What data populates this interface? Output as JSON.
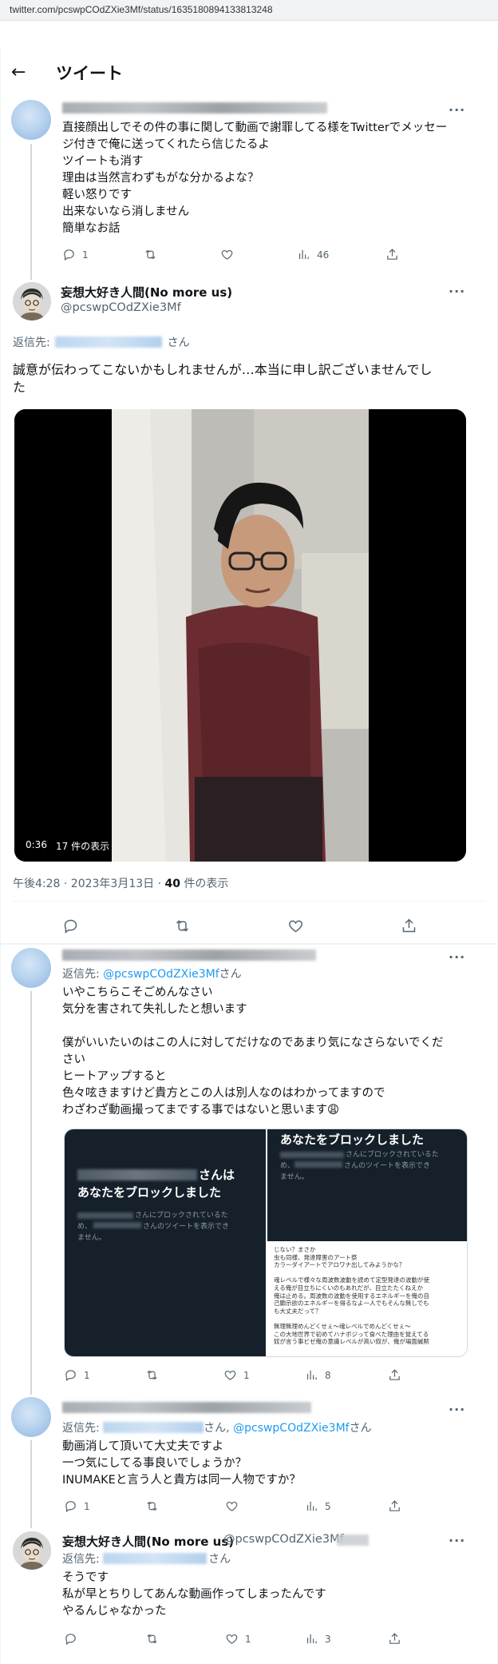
{
  "browser": {
    "url": "twitter.com/pcswpCOdZXie3Mf/status/1635180894133813248"
  },
  "header": {
    "back_icon": "←",
    "title": "ツイート"
  },
  "tweet1": {
    "lines": [
      "直接顔出しでその件の事に関して動画で謝罪してる様をTwitterでメッセー",
      "ジ付きで俺に送ってくれたら信じたるよ",
      "ツイートも消す",
      "理由は当然言わずもがな分かるよな？",
      "軽い怒りです",
      "出来ないなら消しません",
      "簡単なお話"
    ],
    "replies": "1",
    "views": "46"
  },
  "main": {
    "name": "妄想大好き人間(No more us)",
    "handle": "@pcswpCOdZXie3Mf",
    "reply_prefix": "返信先:",
    "reply_suffix": "さん",
    "text_line1": "誠意が伝わってこないかもしれませんが…本当に申し訳ございませんでし",
    "text_line2": "た",
    "video_time": "0:36",
    "video_views": "17 件の表示",
    "meta_time": "午後4:28 · 2023年3月13日 · ",
    "meta_count": "40",
    "meta_suffix": " 件の表示"
  },
  "reply1": {
    "reply_prefix": "返信先: ",
    "reply_mention": "@pcswpCOdZXie3Mf",
    "reply_suffix": "さん",
    "lines": [
      "いやこちらこそごめんなさい",
      "気分を害されて失礼したと想います",
      "",
      "僕がいいたいのはこの人に対してだけなのであまり気になさらないでくだ",
      "さい",
      "ヒートアップすると",
      "色々呟きますけど貴方とこの人は別人なのはわかってますので",
      "わざわざ動画撮ってまでする事ではないと思います😩"
    ],
    "ss_left_title1": "さんは",
    "ss_left_title2": "あなたをブロックしました",
    "ss_left_small1": "さんにブロックされているた",
    "ss_left_small2": "め、",
    "ss_left_small3": "さんのツイートを表示でき",
    "ss_left_small4": "ません。",
    "ss_right_title": "あなたをブロックしました",
    "ss_right_small1": "さんにブロックされているた",
    "ss_right_small2": "め、",
    "ss_right_small3": "さんのツイートを表示でき",
    "ss_right_small4": "ません。",
    "ss_text": [
      "じない？まさか",
      "虫も同様、発達障害のアート祭",
      "カラーダイアートでアロワナ出してみようかな？",
      "",
      "魂レベルで様々な周波数波動を読めて定型発達の波動が使",
      "える俺が目立ちにくいのもあれだが、目立たたくねえか",
      "俺は止める。周波数の波動を使用するエネルギーを俺の自",
      "己顕示欲のエネルギーを得るなよ一人でもそんな無しでも",
      "も大丈夫だって？",
      "",
      "無理無理めんどくせぇ～魂レベルでめんどくせぇ～",
      "この大地世界で初めてハナボジって食べた理由を覚えてる",
      "奴が言う事ビゼ俺の意識レベルが高い奴が、俺が場面緘黙"
    ],
    "replies": "1",
    "likes": "1",
    "views": "8"
  },
  "reply2": {
    "reply_prefix": "返信先: ",
    "reply_mid": "さん, ",
    "reply_mention": "@pcswpCOdZXie3Mf",
    "reply_suffix": "さん",
    "lines": [
      "動画消して頂いて大丈夫ですよ",
      "一つ気にしてる事良いでしょうか？",
      "INUMAKEと言う人と貴方は同一人物ですか？"
    ],
    "replies": "1",
    "views": "5"
  },
  "reply3": {
    "name": "妄想大好き人間(No more us)",
    "handle": "@pcswpCOdZXie3Mf",
    "reply_prefix": "返信先: ",
    "reply_suffix": "さん",
    "lines": [
      "そうです",
      "私が早とちりしてあんな動画作ってしまったんです",
      "やるんじゃなかった"
    ],
    "likes": "1",
    "views": "3"
  },
  "icons": [
    "back-arrow",
    "more-dots",
    "reply",
    "retweet",
    "like",
    "views-chart",
    "share"
  ]
}
